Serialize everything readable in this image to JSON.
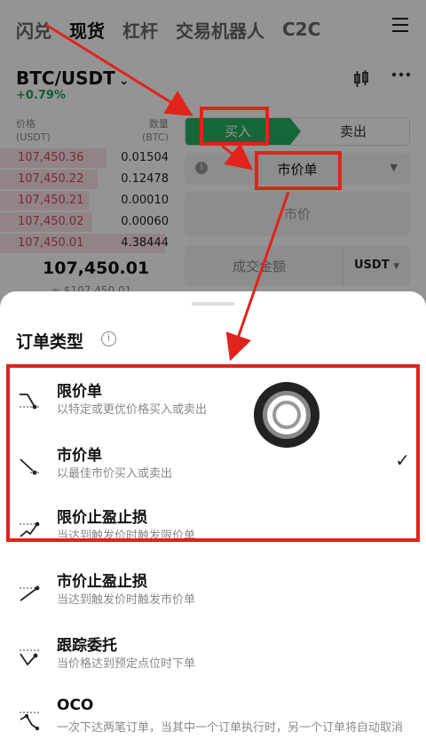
{
  "nav": {
    "tabs": [
      "闪兑",
      "现货",
      "杠杆",
      "交易机器人",
      "C2C"
    ],
    "active_index": 1
  },
  "market": {
    "pair": "BTC/USDT",
    "change": "+0.79%"
  },
  "orderbook": {
    "price_header": "价格\n(USDT)",
    "qty_header": "数量\n(BTC)",
    "rows": [
      {
        "price": "107,450.36",
        "qty": "0.01504"
      },
      {
        "price": "107,450.22",
        "qty": "0.12478"
      },
      {
        "price": "107,450.21",
        "qty": "0.00010"
      },
      {
        "price": "107,450.02",
        "qty": "0.00060"
      },
      {
        "price": "107,450.01",
        "qty": "4.38444"
      }
    ],
    "last_price": "107,450.01",
    "last_price_usd": "≈ $107,450.01"
  },
  "trade_form": {
    "buy_label": "买入",
    "sell_label": "卖出",
    "order_type": "市价单",
    "price_placeholder": "市价",
    "amount_label": "成交金额",
    "amount_unit": "USDT"
  },
  "sheet": {
    "title": "订单类型",
    "options": [
      {
        "name": "限价单",
        "desc": "以特定或更优价格买入或卖出",
        "selected": false,
        "icon": "limit-order-icon"
      },
      {
        "name": "市价单",
        "desc": "以最佳市价买入或卖出",
        "selected": true,
        "icon": "market-order-icon"
      },
      {
        "name": "限价止盈止损",
        "desc": "当达到触发价时触发限价单",
        "selected": false,
        "icon": "limit-tpsl-icon"
      },
      {
        "name": "市价止盈止损",
        "desc": "当达到触发价时触发市价单",
        "selected": false,
        "icon": "market-tpsl-icon"
      },
      {
        "name": "跟踪委托",
        "desc": "当价格达到预定点位时下单",
        "selected": false,
        "icon": "trailing-order-icon"
      },
      {
        "name": "OCO",
        "desc": "一次下达两笔订单，当其中一个订单执行时，另一个订单将自动取消",
        "selected": false,
        "icon": "oco-icon"
      }
    ]
  },
  "colors": {
    "buy": "#25b15f",
    "ask": "#d0485a",
    "annotation": "#e0231c"
  }
}
